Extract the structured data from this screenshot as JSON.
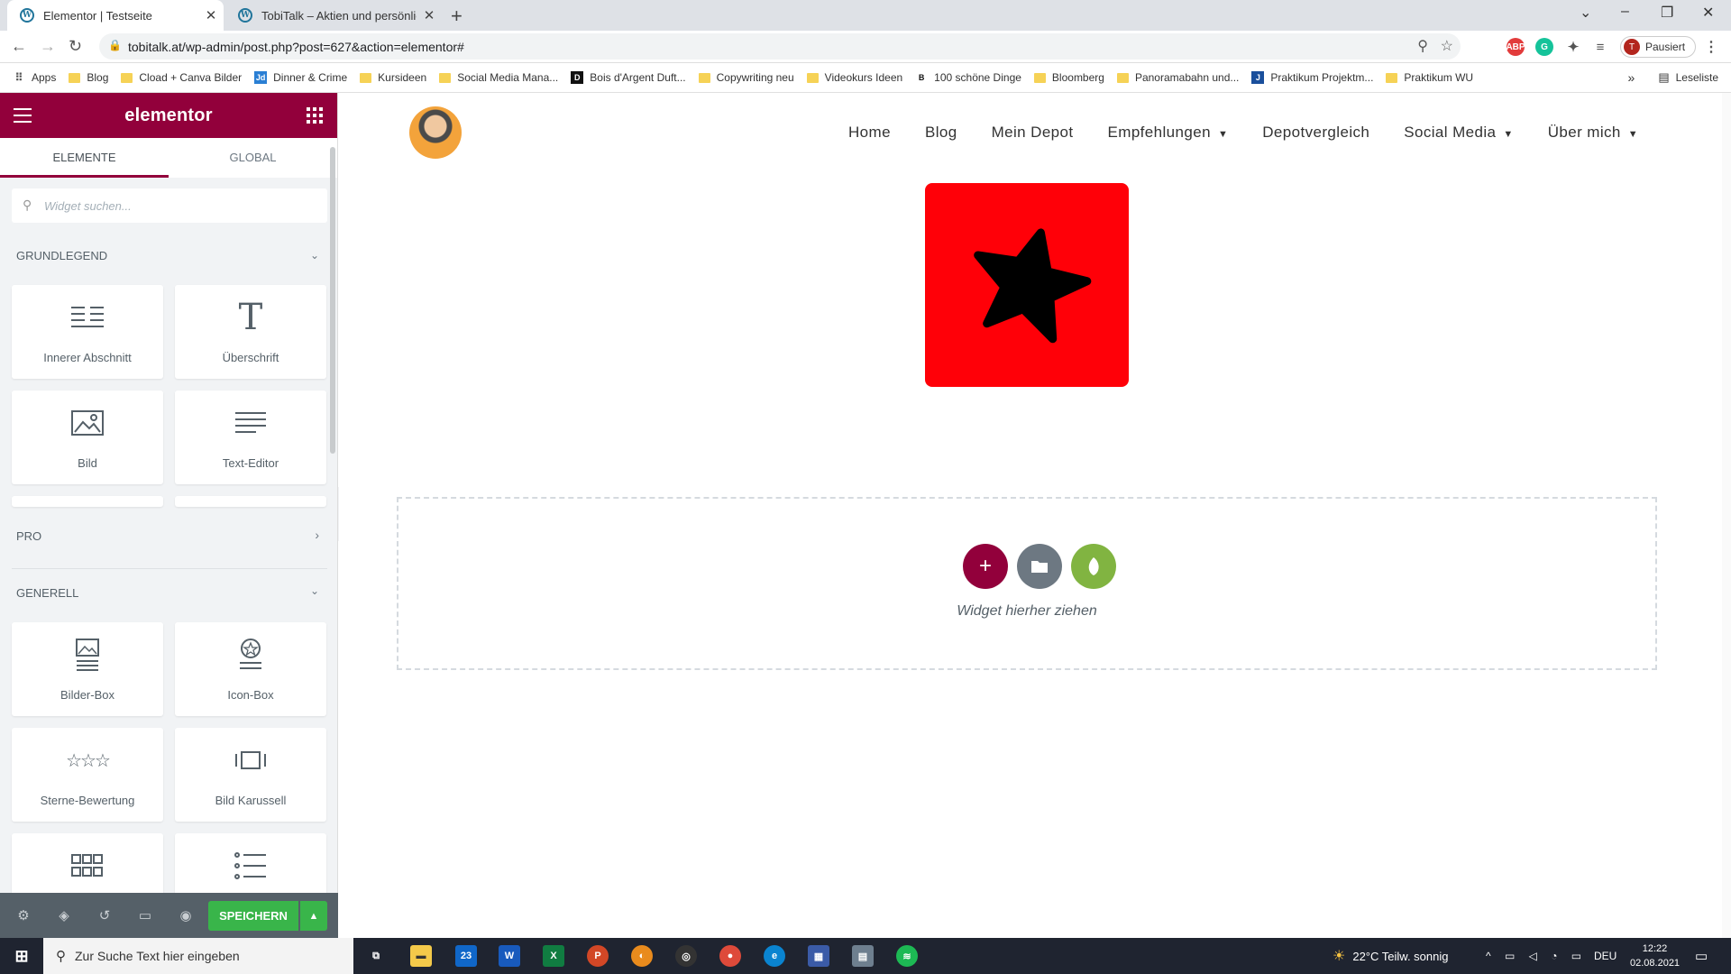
{
  "browser": {
    "tabs": [
      {
        "title": "Elementor | Testseite",
        "active": true
      },
      {
        "title": "TobiTalk – Aktien und persönliche",
        "active": false
      }
    ],
    "url": "tobitalk.at/wp-admin/post.php?post=627&action=elementor#",
    "profile_label": "Pausiert",
    "profile_initial": "T",
    "bookmarks": [
      {
        "label": "Apps",
        "icon": "apps-grid-icon"
      },
      {
        "label": "Blog",
        "icon": "folder-icon"
      },
      {
        "label": "Cload + Canva Bilder",
        "icon": "folder-icon"
      },
      {
        "label": "Dinner & Crime",
        "icon": "jd-icon"
      },
      {
        "label": "Kursideen",
        "icon": "folder-icon"
      },
      {
        "label": "Social Media Mana...",
        "icon": "folder-icon"
      },
      {
        "label": "Bois d'Argent Duft...",
        "icon": "dior-icon"
      },
      {
        "label": "Copywriting neu",
        "icon": "folder-icon"
      },
      {
        "label": "Videokurs Ideen",
        "icon": "folder-icon"
      },
      {
        "label": "100 schöne Dinge",
        "icon": "b-icon"
      },
      {
        "label": "Bloomberg",
        "icon": "folder-icon"
      },
      {
        "label": "Panoramabahn und...",
        "icon": "folder-icon"
      },
      {
        "label": "Praktikum Projektm...",
        "icon": "j-icon"
      },
      {
        "label": "Praktikum WU",
        "icon": "folder-icon"
      }
    ],
    "reading_list": "Leseliste",
    "more_bookmarks": "»"
  },
  "panel": {
    "logo": "elementor",
    "tabs": [
      "ELEMENTE",
      "GLOBAL"
    ],
    "search_placeholder": "Widget suchen...",
    "categories": {
      "basic": "GRUNDLEGEND",
      "pro": "PRO",
      "general": "GENERELL"
    },
    "basic_widgets": [
      {
        "label": "Innerer Abschnitt",
        "icon": "inner-section-icon"
      },
      {
        "label": "Überschrift",
        "icon": "heading-icon"
      },
      {
        "label": "Bild",
        "icon": "image-icon"
      },
      {
        "label": "Text-Editor",
        "icon": "text-editor-icon"
      }
    ],
    "general_widgets": [
      {
        "label": "Bilder-Box",
        "icon": "image-box-icon"
      },
      {
        "label": "Icon-Box",
        "icon": "icon-box-icon"
      },
      {
        "label": "Sterne-Bewertung",
        "icon": "star-rating-icon"
      },
      {
        "label": "Bild Karussell",
        "icon": "image-carousel-icon"
      },
      {
        "label": "",
        "icon": "gallery-icon"
      },
      {
        "label": "",
        "icon": "icon-list-icon"
      }
    ],
    "save_label": "SPEICHERN"
  },
  "site": {
    "nav": [
      {
        "label": "Home",
        "dropdown": false
      },
      {
        "label": "Blog",
        "dropdown": false
      },
      {
        "label": "Mein Depot",
        "dropdown": false
      },
      {
        "label": "Empfehlungen",
        "dropdown": true
      },
      {
        "label": "Depotvergleich",
        "dropdown": false
      },
      {
        "label": "Social Media",
        "dropdown": true
      },
      {
        "label": "Über mich",
        "dropdown": true
      }
    ],
    "dropzone_text": "Widget hierher ziehen",
    "colors": {
      "hero": "#ff0008",
      "brand": "#92003b",
      "save": "#39b54a",
      "template_btn": "#6d7882",
      "envato_btn": "#81b441"
    }
  },
  "taskbar": {
    "search_placeholder": "Zur Suche Text hier eingeben",
    "mail_badge": "23",
    "weather": "22°C  Teilw. sonnig",
    "language": "DEU",
    "time": "12:22",
    "date": "02.08.2021"
  }
}
